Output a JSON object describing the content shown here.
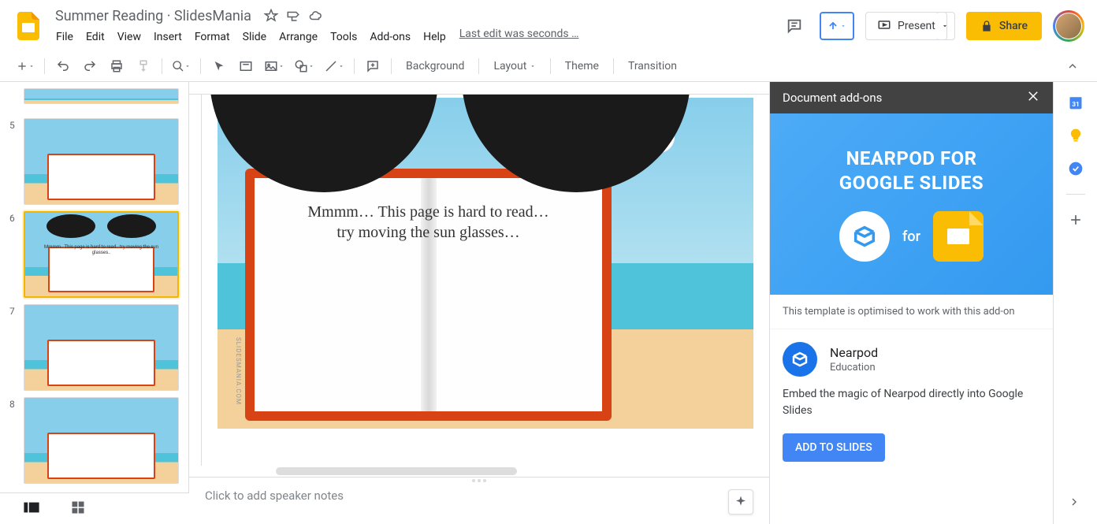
{
  "header": {
    "title": "Summer Reading · SlidesMania",
    "menus": [
      "File",
      "Edit",
      "View",
      "Insert",
      "Format",
      "Slide",
      "Arrange",
      "Tools",
      "Add-ons",
      "Help"
    ],
    "last_edit": "Last edit was seconds …",
    "present": "Present",
    "share": "Share"
  },
  "toolbar": {
    "background": "Background",
    "layout": "Layout",
    "theme": "Theme",
    "transition": "Transition"
  },
  "filmstrip": {
    "slides": [
      {
        "num": "5",
        "text": ""
      },
      {
        "num": "6",
        "text": "Mmmm.. This page is hard to read.. try moving the sun glasses..",
        "selected": true
      },
      {
        "num": "7",
        "text": ""
      },
      {
        "num": "8",
        "text": ""
      }
    ]
  },
  "canvas": {
    "book_text_1": "Mmmm… This page is hard to read…",
    "book_text_2": "try moving the sun glasses…",
    "watermark": "SLIDESMANIA.COM"
  },
  "speaker_notes": {
    "placeholder": "Click to add speaker notes"
  },
  "addons": {
    "panel_title": "Document add-ons",
    "banner_line1": "NEARPOD FOR",
    "banner_line2": "GOOGLE SLIDES",
    "banner_for": "for",
    "note": "This template is optimised to work with this add-on",
    "name": "Nearpod",
    "category": "Education",
    "desc": "Embed the magic of Nearpod directly into Google Slides",
    "cta": "ADD TO SLIDES"
  }
}
